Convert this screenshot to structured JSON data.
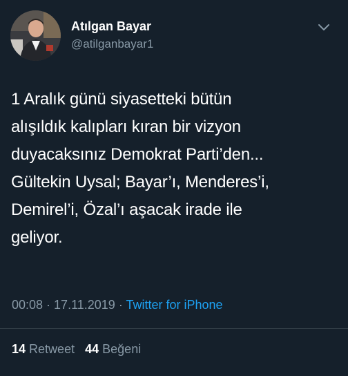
{
  "author": {
    "name": "Atılgan Bayar",
    "handle": "@atilganbayar1"
  },
  "icons": {
    "menu": "chevron-down-icon",
    "avatar": "profile-photo"
  },
  "colors": {
    "background": "#15202b",
    "secondary_text": "#8899a6",
    "link": "#1da1f2",
    "divider": "#38444d"
  },
  "tweet": {
    "lines": [
      "1 Aralık günü siyasetteki bütün",
      "alışıldık kalıpları kıran bir vizyon",
      "duyacaksınız Demokrat Parti’den...",
      "Gültekin Uysal; Bayar’ı, Menderes’i,",
      "Demirel’i, Özal’ı aşacak irade ile",
      "geliyor."
    ]
  },
  "meta": {
    "time": "00:08",
    "separator1": " · ",
    "date": "17.11.2019",
    "separator2": " · ",
    "source": "Twitter for iPhone"
  },
  "stats": {
    "retweets": "14",
    "retweets_label": "Retweet",
    "likes": "44",
    "likes_label": "Beğeni"
  }
}
